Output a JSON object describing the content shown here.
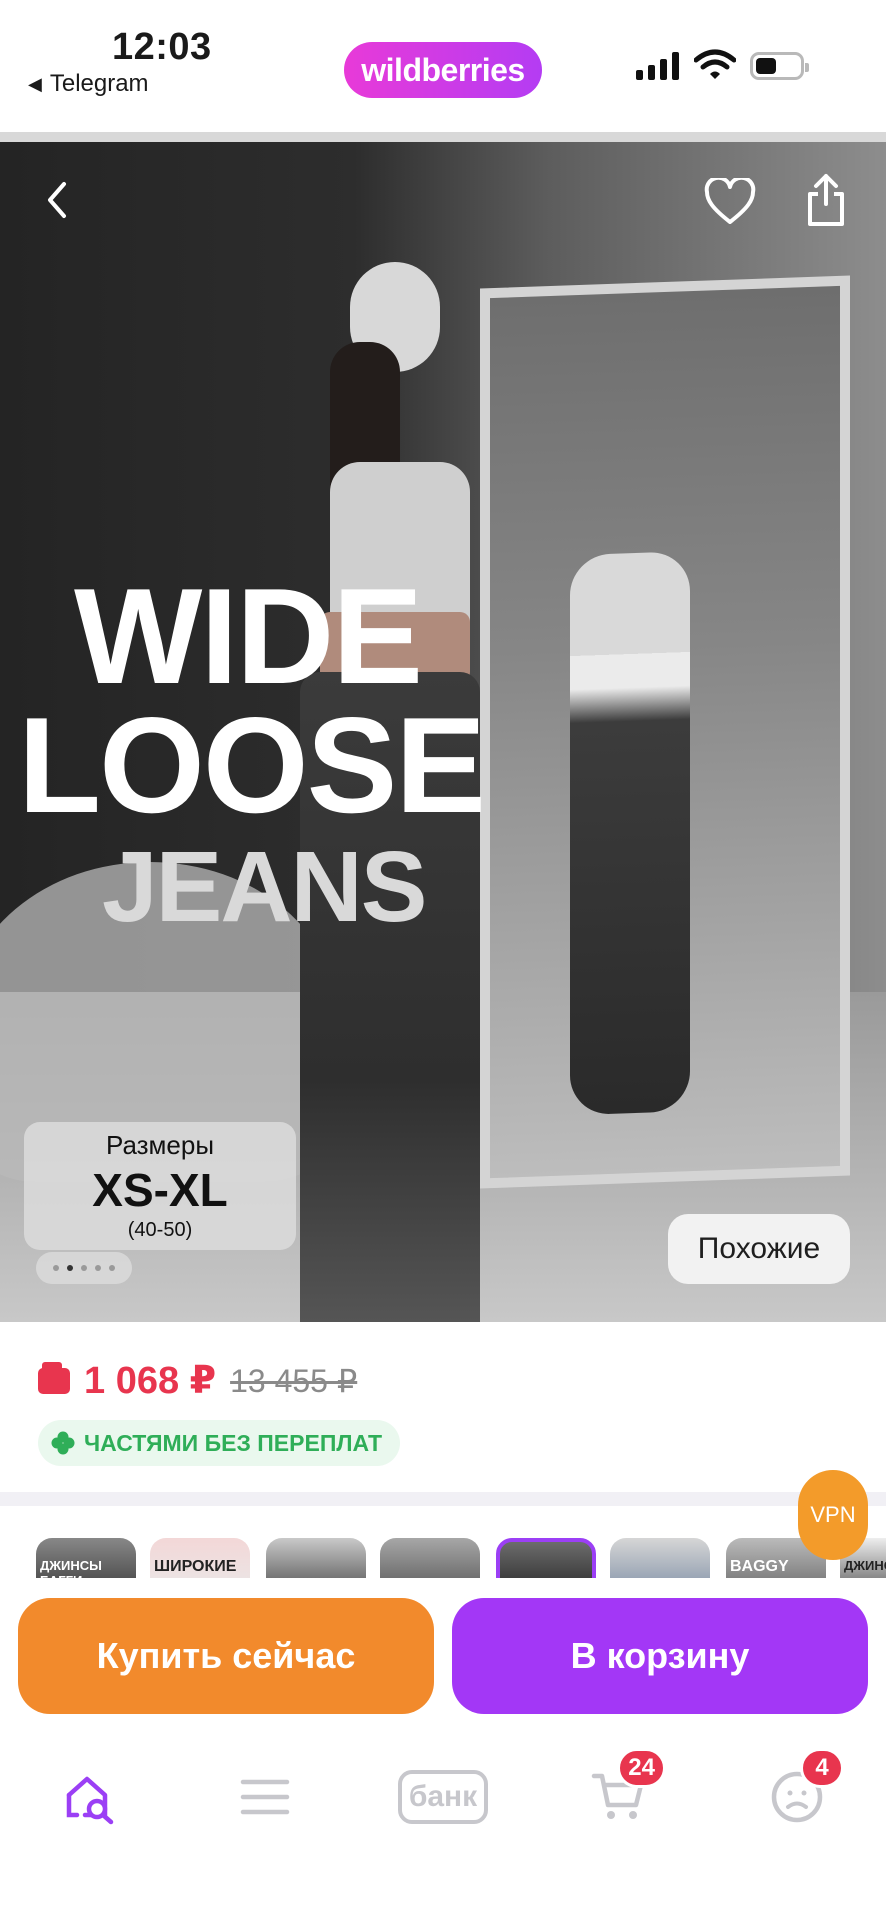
{
  "status_bar": {
    "time": "12:03",
    "back_app": "Telegram",
    "back_icon": "triangle-left-icon",
    "brand": "wildberries"
  },
  "hero": {
    "headline_line1": "WIDE",
    "headline_line2": "LOOSE",
    "headline_line3": "JEANS",
    "sizes_title": "Размеры",
    "sizes_range": "XS-XL",
    "sizes_numeric": "(40-50)",
    "similar_label": "Похожие",
    "pager_count": 5,
    "pager_active": 2
  },
  "price": {
    "current": "1 068 ₽",
    "old": "13 455 ₽",
    "installments_label": "ЧАСТЯМИ БЕЗ ПЕРЕПЛАТ",
    "accent_color": "#e8354e"
  },
  "thumbnails": {
    "items": [
      {
        "label": "ДЖИНСЫ БАГГИ"
      },
      {
        "label": "ШИРОКИЕ"
      },
      {
        "label": ""
      },
      {
        "label": ""
      },
      {
        "label": ""
      },
      {
        "label": ""
      },
      {
        "label": "BAGGY"
      },
      {
        "label": "ДЖИНС"
      }
    ],
    "selected_index": 4
  },
  "vpn_label": "VPN",
  "actions": {
    "buy_now": "Купить сейчас",
    "add_to_cart": "В корзину",
    "buy_color": "#f28a2c",
    "cart_color": "#a337f6"
  },
  "tabbar": {
    "bank_label": "банк",
    "cart_badge": "24",
    "profile_badge": "4",
    "active_color": "#9b3ff5"
  }
}
